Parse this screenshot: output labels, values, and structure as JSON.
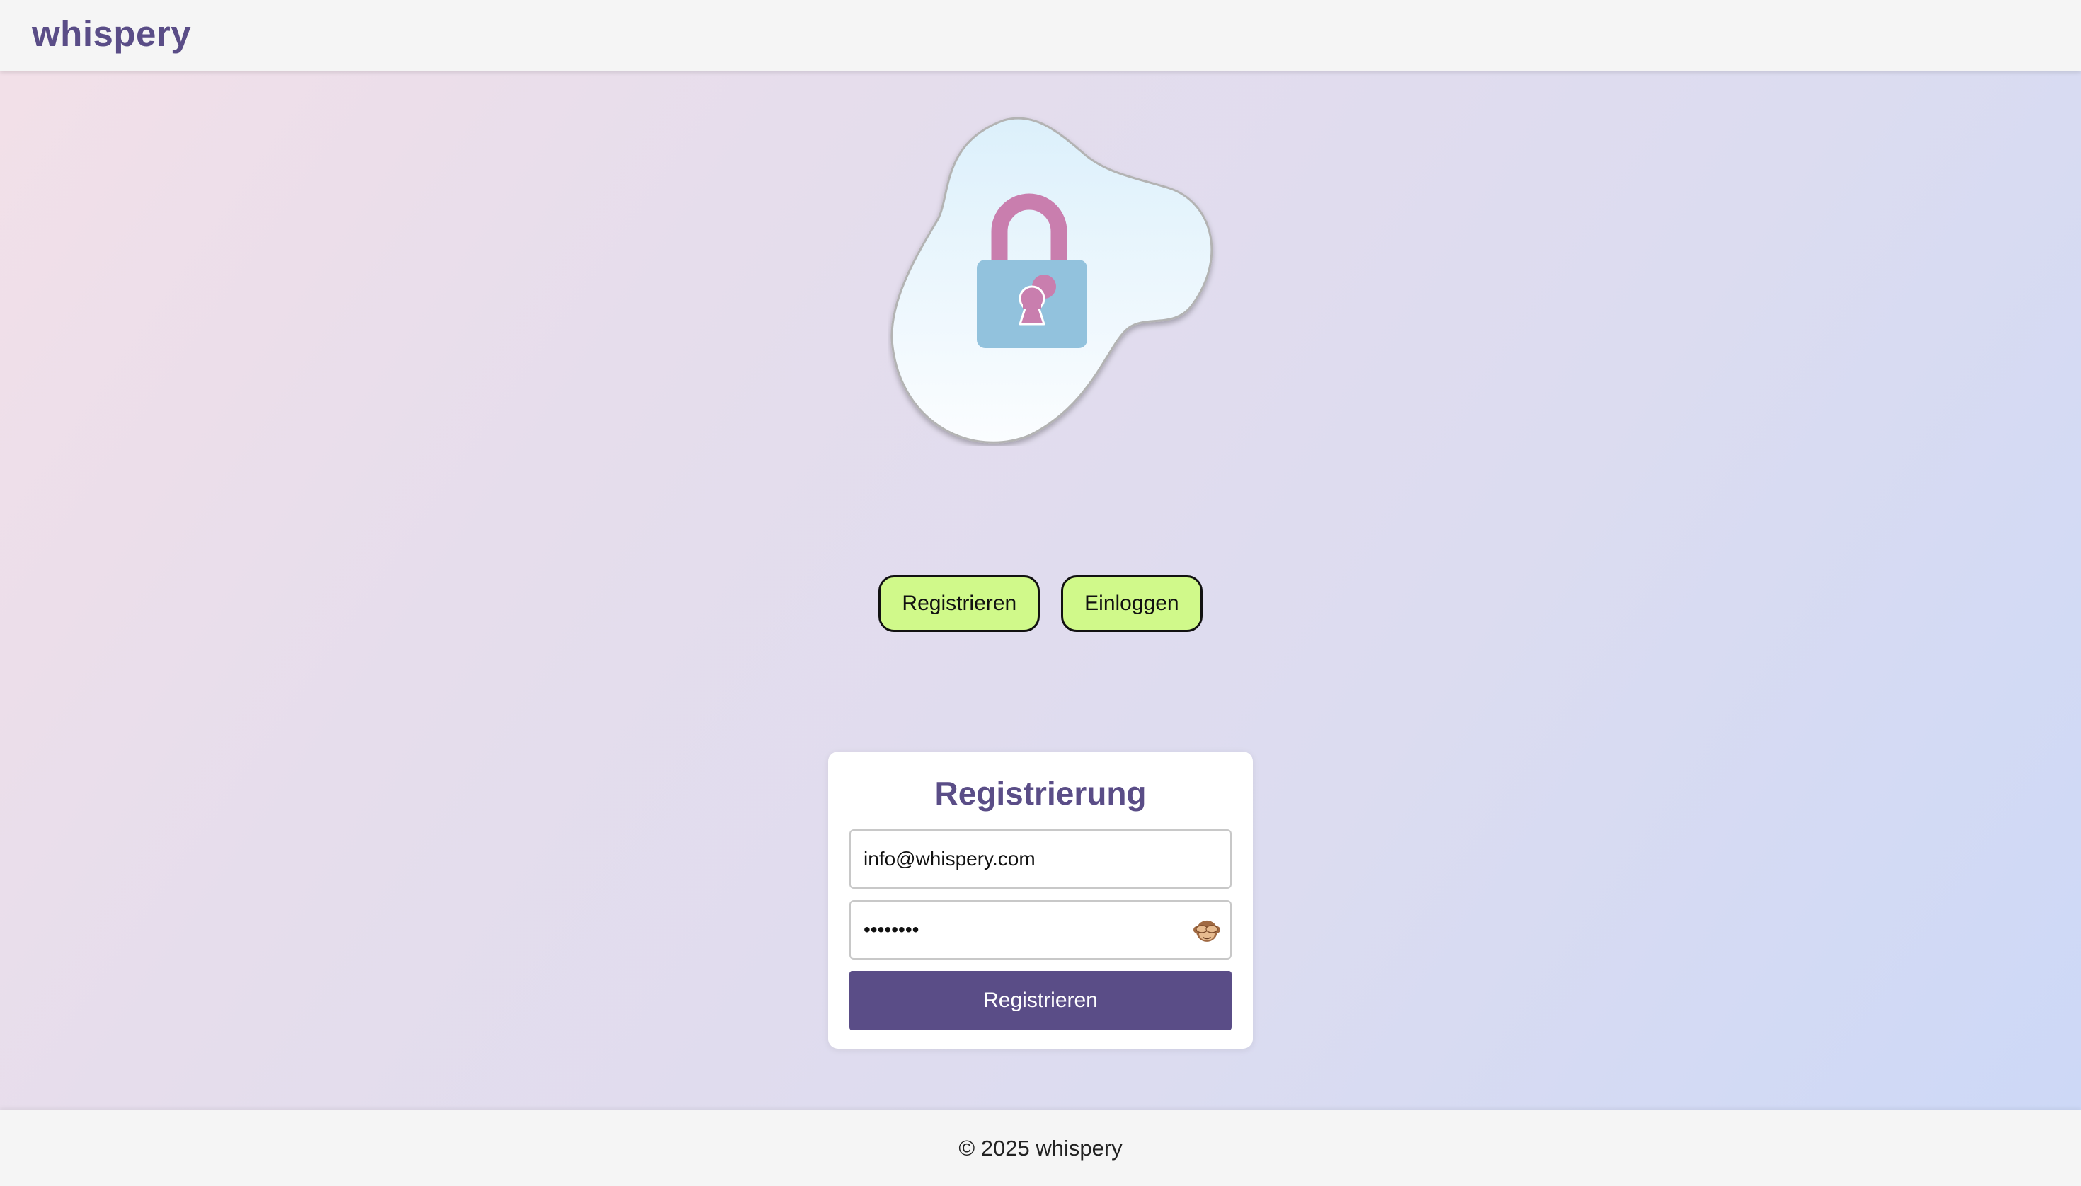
{
  "header": {
    "brand": "whispery"
  },
  "hero": {
    "icon": "lock-icon"
  },
  "toggle": {
    "register_label": "Registrieren",
    "login_label": "Einloggen"
  },
  "form": {
    "title": "Registrierung",
    "email_value": "info@whispery.com",
    "password_value": "password",
    "password_toggle_icon": "see-no-evil-monkey-icon",
    "submit_label": "Registrieren"
  },
  "footer": {
    "copyright": "© 2025 whispery"
  },
  "colors": {
    "brand": "#5a4d87",
    "pill_bg": "#d0f98a",
    "lock_shackle": "#c97eae",
    "lock_body": "#92c2dd"
  }
}
